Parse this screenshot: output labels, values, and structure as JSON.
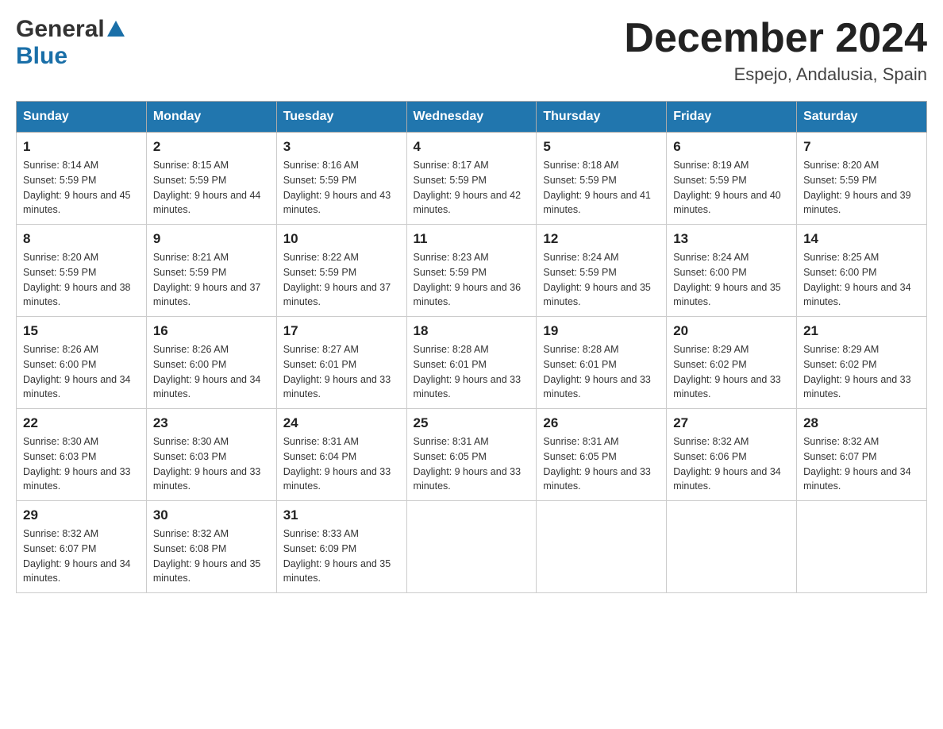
{
  "header": {
    "logo_general": "General",
    "logo_blue": "Blue",
    "title": "December 2024",
    "subtitle": "Espejo, Andalusia, Spain"
  },
  "calendar": {
    "headers": [
      "Sunday",
      "Monday",
      "Tuesday",
      "Wednesday",
      "Thursday",
      "Friday",
      "Saturday"
    ],
    "weeks": [
      [
        {
          "day": "1",
          "sunrise": "8:14 AM",
          "sunset": "5:59 PM",
          "daylight": "9 hours and 45 minutes."
        },
        {
          "day": "2",
          "sunrise": "8:15 AM",
          "sunset": "5:59 PM",
          "daylight": "9 hours and 44 minutes."
        },
        {
          "day": "3",
          "sunrise": "8:16 AM",
          "sunset": "5:59 PM",
          "daylight": "9 hours and 43 minutes."
        },
        {
          "day": "4",
          "sunrise": "8:17 AM",
          "sunset": "5:59 PM",
          "daylight": "9 hours and 42 minutes."
        },
        {
          "day": "5",
          "sunrise": "8:18 AM",
          "sunset": "5:59 PM",
          "daylight": "9 hours and 41 minutes."
        },
        {
          "day": "6",
          "sunrise": "8:19 AM",
          "sunset": "5:59 PM",
          "daylight": "9 hours and 40 minutes."
        },
        {
          "day": "7",
          "sunrise": "8:20 AM",
          "sunset": "5:59 PM",
          "daylight": "9 hours and 39 minutes."
        }
      ],
      [
        {
          "day": "8",
          "sunrise": "8:20 AM",
          "sunset": "5:59 PM",
          "daylight": "9 hours and 38 minutes."
        },
        {
          "day": "9",
          "sunrise": "8:21 AM",
          "sunset": "5:59 PM",
          "daylight": "9 hours and 37 minutes."
        },
        {
          "day": "10",
          "sunrise": "8:22 AM",
          "sunset": "5:59 PM",
          "daylight": "9 hours and 37 minutes."
        },
        {
          "day": "11",
          "sunrise": "8:23 AM",
          "sunset": "5:59 PM",
          "daylight": "9 hours and 36 minutes."
        },
        {
          "day": "12",
          "sunrise": "8:24 AM",
          "sunset": "5:59 PM",
          "daylight": "9 hours and 35 minutes."
        },
        {
          "day": "13",
          "sunrise": "8:24 AM",
          "sunset": "6:00 PM",
          "daylight": "9 hours and 35 minutes."
        },
        {
          "day": "14",
          "sunrise": "8:25 AM",
          "sunset": "6:00 PM",
          "daylight": "9 hours and 34 minutes."
        }
      ],
      [
        {
          "day": "15",
          "sunrise": "8:26 AM",
          "sunset": "6:00 PM",
          "daylight": "9 hours and 34 minutes."
        },
        {
          "day": "16",
          "sunrise": "8:26 AM",
          "sunset": "6:00 PM",
          "daylight": "9 hours and 34 minutes."
        },
        {
          "day": "17",
          "sunrise": "8:27 AM",
          "sunset": "6:01 PM",
          "daylight": "9 hours and 33 minutes."
        },
        {
          "day": "18",
          "sunrise": "8:28 AM",
          "sunset": "6:01 PM",
          "daylight": "9 hours and 33 minutes."
        },
        {
          "day": "19",
          "sunrise": "8:28 AM",
          "sunset": "6:01 PM",
          "daylight": "9 hours and 33 minutes."
        },
        {
          "day": "20",
          "sunrise": "8:29 AM",
          "sunset": "6:02 PM",
          "daylight": "9 hours and 33 minutes."
        },
        {
          "day": "21",
          "sunrise": "8:29 AM",
          "sunset": "6:02 PM",
          "daylight": "9 hours and 33 minutes."
        }
      ],
      [
        {
          "day": "22",
          "sunrise": "8:30 AM",
          "sunset": "6:03 PM",
          "daylight": "9 hours and 33 minutes."
        },
        {
          "day": "23",
          "sunrise": "8:30 AM",
          "sunset": "6:03 PM",
          "daylight": "9 hours and 33 minutes."
        },
        {
          "day": "24",
          "sunrise": "8:31 AM",
          "sunset": "6:04 PM",
          "daylight": "9 hours and 33 minutes."
        },
        {
          "day": "25",
          "sunrise": "8:31 AM",
          "sunset": "6:05 PM",
          "daylight": "9 hours and 33 minutes."
        },
        {
          "day": "26",
          "sunrise": "8:31 AM",
          "sunset": "6:05 PM",
          "daylight": "9 hours and 33 minutes."
        },
        {
          "day": "27",
          "sunrise": "8:32 AM",
          "sunset": "6:06 PM",
          "daylight": "9 hours and 34 minutes."
        },
        {
          "day": "28",
          "sunrise": "8:32 AM",
          "sunset": "6:07 PM",
          "daylight": "9 hours and 34 minutes."
        }
      ],
      [
        {
          "day": "29",
          "sunrise": "8:32 AM",
          "sunset": "6:07 PM",
          "daylight": "9 hours and 34 minutes."
        },
        {
          "day": "30",
          "sunrise": "8:32 AM",
          "sunset": "6:08 PM",
          "daylight": "9 hours and 35 minutes."
        },
        {
          "day": "31",
          "sunrise": "8:33 AM",
          "sunset": "6:09 PM",
          "daylight": "9 hours and 35 minutes."
        },
        null,
        null,
        null,
        null
      ]
    ]
  }
}
